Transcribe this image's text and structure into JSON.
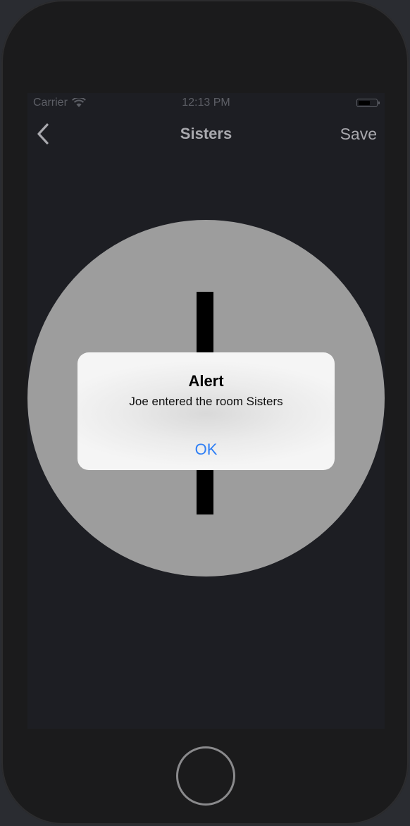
{
  "status_bar": {
    "carrier": "Carrier",
    "time": "12:13 PM"
  },
  "nav": {
    "title": "Sisters",
    "save_label": "Save",
    "back_icon": "chevron-left-icon"
  },
  "alert": {
    "title": "Alert",
    "message": "Joe entered the room Sisters",
    "ok_label": "OK"
  },
  "colors": {
    "alert_button": "#2f7ff5",
    "dial": "#9d9d9d",
    "screen_background": "#1d1e23"
  }
}
